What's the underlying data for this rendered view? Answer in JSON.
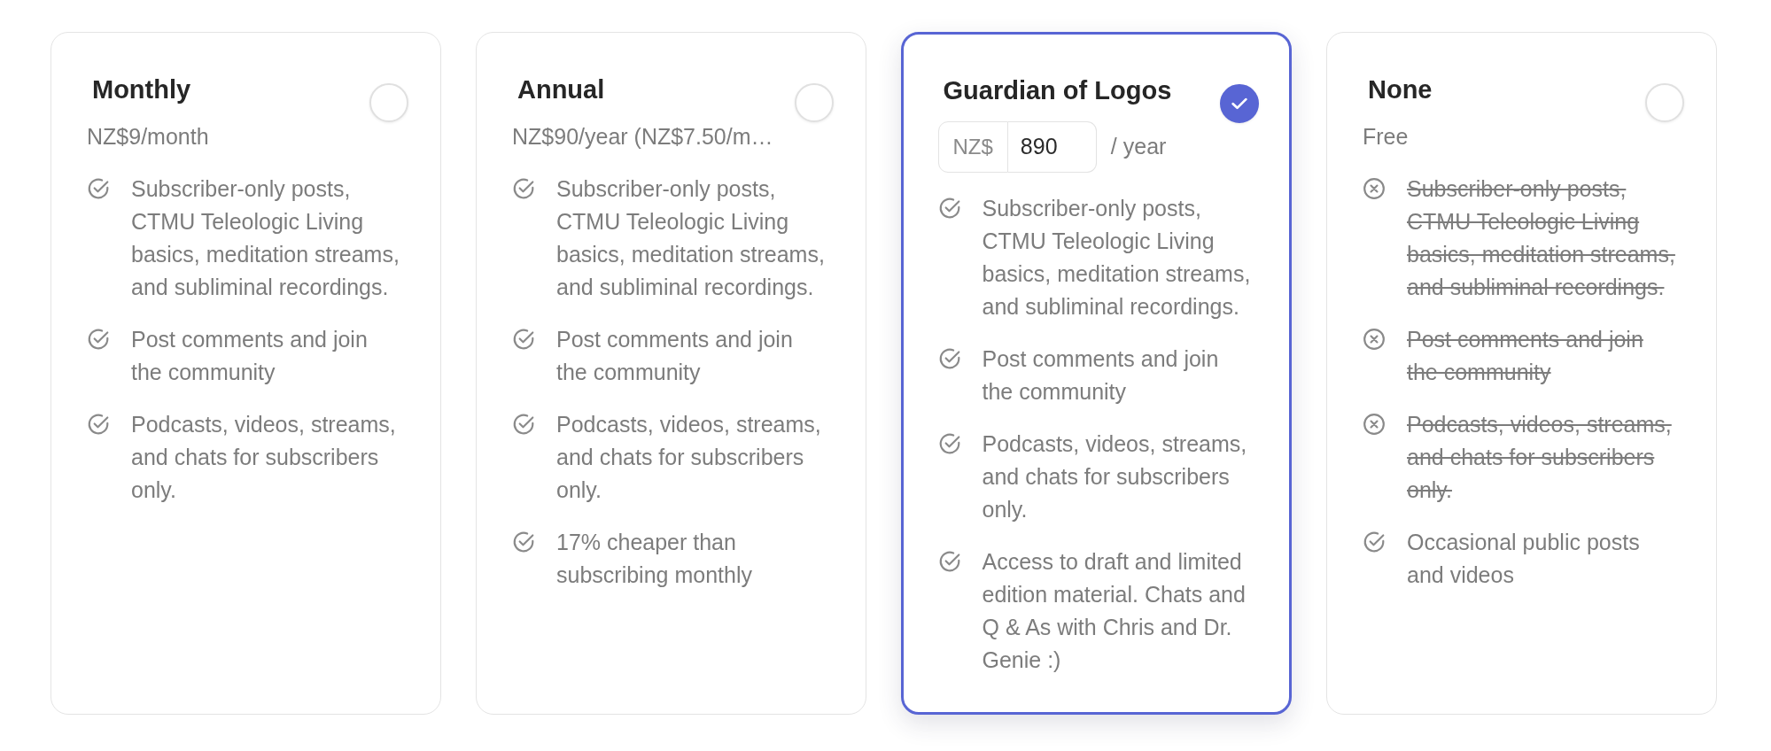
{
  "plans": [
    {
      "name": "Monthly",
      "selected": false,
      "price": "NZ$9/month",
      "features": [
        {
          "kind": "included",
          "text": "Subscriber-only posts, CTMU Teleologic Living basics, meditation streams, and subliminal recordings."
        },
        {
          "kind": "included",
          "text": "Post comments and join the community"
        },
        {
          "kind": "included",
          "text": "Podcasts, videos, streams, and chats for subscribers only."
        }
      ]
    },
    {
      "name": "Annual",
      "selected": false,
      "price": "NZ$90/year (NZ$7.50/m…",
      "features": [
        {
          "kind": "included",
          "text": "Subscriber-only posts, CTMU Teleologic Living basics, meditation streams, and subliminal recordings."
        },
        {
          "kind": "included",
          "text": "Post comments and join the community"
        },
        {
          "kind": "included",
          "text": "Podcasts, videos, streams, and chats for subscribers only."
        },
        {
          "kind": "included",
          "text": "17% cheaper than subscribing monthly"
        }
      ]
    },
    {
      "name": "Guardian of Logos",
      "selected": true,
      "price_input": {
        "prefix": "NZ$",
        "value": "890",
        "suffix": "/ year"
      },
      "features": [
        {
          "kind": "included",
          "text": "Subscriber-only posts, CTMU Teleologic Living basics, meditation streams, and subliminal recordings."
        },
        {
          "kind": "included",
          "text": "Post comments and join the community"
        },
        {
          "kind": "included",
          "text": "Podcasts, videos, streams, and chats for subscribers only."
        },
        {
          "kind": "included",
          "text": "Access to draft and limited edition material. Chats and Q & As with Chris and Dr. Genie :)"
        }
      ]
    },
    {
      "name": "None",
      "selected": false,
      "price": "Free",
      "features": [
        {
          "kind": "excluded",
          "text": "Subscriber-only posts, CTMU Teleologic Living basics, meditation streams, and subliminal recordings."
        },
        {
          "kind": "excluded",
          "text": "Post comments and join the community"
        },
        {
          "kind": "excluded",
          "text": "Podcasts, videos, streams, and chats for subscribers only."
        },
        {
          "kind": "included",
          "text": "Occasional public posts and videos"
        }
      ]
    }
  ]
}
